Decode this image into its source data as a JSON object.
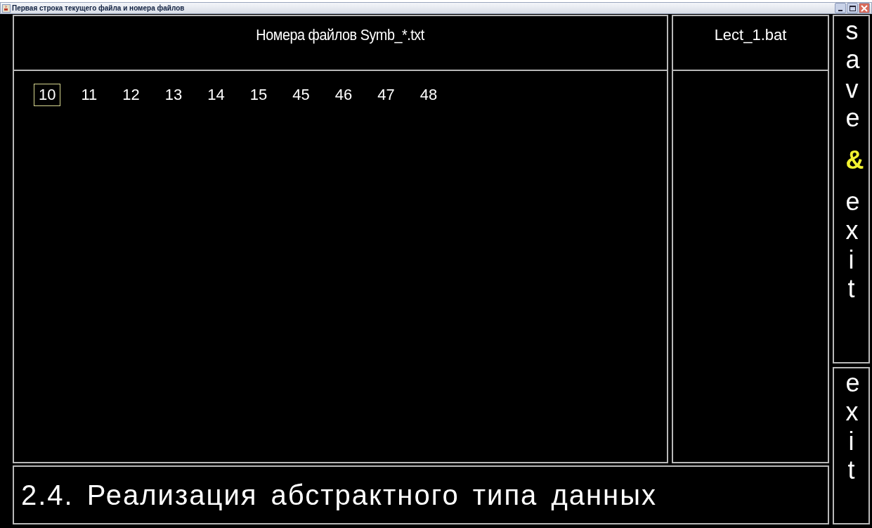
{
  "window": {
    "title": "Первая строка текущего файла и номера файлов"
  },
  "files_panel": {
    "title": "Номера файлов Symb_*.txt",
    "numbers": [
      {
        "label": "10",
        "selected": true
      },
      {
        "label": "11",
        "selected": false
      },
      {
        "label": "12",
        "selected": false
      },
      {
        "label": "13",
        "selected": false
      },
      {
        "label": "14",
        "selected": false
      },
      {
        "label": "15",
        "selected": false
      },
      {
        "label": "45",
        "selected": false
      },
      {
        "label": "46",
        "selected": false
      },
      {
        "label": "47",
        "selected": false
      },
      {
        "label": "48",
        "selected": false
      }
    ]
  },
  "bat_panel": {
    "title": "Lect_1.bat"
  },
  "first_line": "2.4. Реализация абстрактного типа данных",
  "buttons": [
    {
      "parts": [
        {
          "text": "save",
          "accent": false
        },
        {
          "text": "&",
          "accent": true
        },
        {
          "text": "exit",
          "accent": false
        }
      ]
    },
    {
      "parts": [
        {
          "text": "exit",
          "accent": false
        }
      ]
    }
  ]
}
